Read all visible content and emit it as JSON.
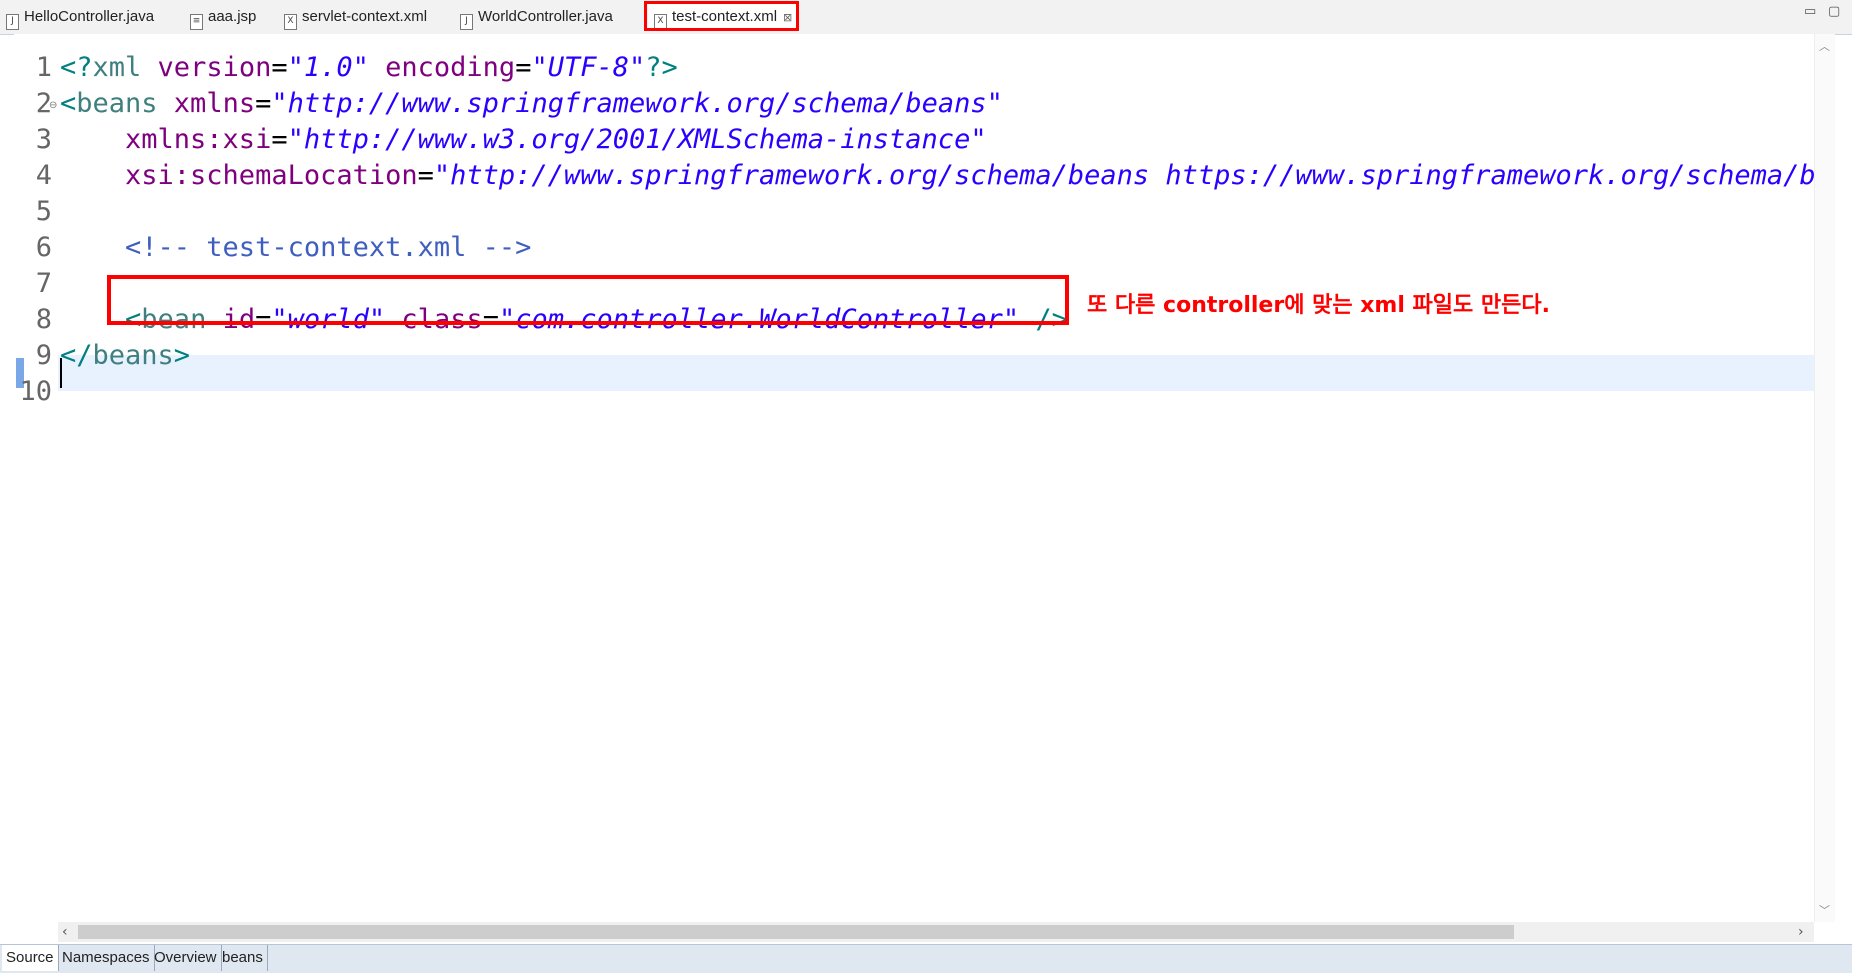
{
  "tabs": [
    {
      "label": "HelloController.java",
      "icon": "java-file-icon",
      "active": false
    },
    {
      "label": "aaa.jsp",
      "icon": "jsp-file-icon",
      "active": false
    },
    {
      "label": "servlet-context.xml",
      "icon": "xml-file-icon",
      "active": false
    },
    {
      "label": "WorldController.java",
      "icon": "java-file-icon",
      "active": false
    },
    {
      "label": "test-context.xml",
      "icon": "xml-file-icon",
      "active": true,
      "close": "⊠"
    }
  ],
  "editor": {
    "line_numbers": [
      "1",
      "2",
      "3",
      "4",
      "5",
      "6",
      "7",
      "8",
      "9",
      "10"
    ],
    "current_line": "10",
    "lines": {
      "l1": {
        "b1": "<?",
        "tag": "xml",
        "a1": " version",
        "eq1": "=",
        "s1": "\"1.0\"",
        "a2": " encoding",
        "eq2": "=",
        "s2": "\"UTF-8\"",
        "b2": "?>"
      },
      "l2": {
        "b1": "<",
        "tag": "beans",
        "a1": " xmlns",
        "eq1": "=",
        "s1": "\"http://www.springframework.org/schema/beans\""
      },
      "l3": {
        "a1": "    xmlns:xsi",
        "eq1": "=",
        "s1": "\"http://www.w3.org/2001/XMLSchema-instance\""
      },
      "l4": {
        "a1": "    xsi:schemaLocation",
        "eq1": "=",
        "s1": "\"http://www.springframework.org/schema/beans https://www.springframework.org/schema/bea"
      },
      "l6": {
        "comment": "    <!-- test-context.xml -->"
      },
      "l8": {
        "indent": "    ",
        "b1": "<",
        "tag": "bean",
        "a1": " id",
        "eq1": "=",
        "s1": "\"world\"",
        "a2": " class",
        "eq2": "=",
        "s2": "\"com.controller.WorldController\"",
        "b2": " />"
      },
      "l9": {
        "b1": "</",
        "tag": "beans",
        "b2": ">"
      }
    }
  },
  "annotation": "또 다른 controller에 맞는 xml 파일도 만든다.",
  "bottom_tabs": [
    "Source",
    "Namespaces",
    "Overview",
    "beans"
  ],
  "colors": {
    "highlight": "#ff0000",
    "string": "#2a00ff",
    "attribute": "#7f007f",
    "tag": "#3f7f7f",
    "comment": "#3f5fbf"
  }
}
